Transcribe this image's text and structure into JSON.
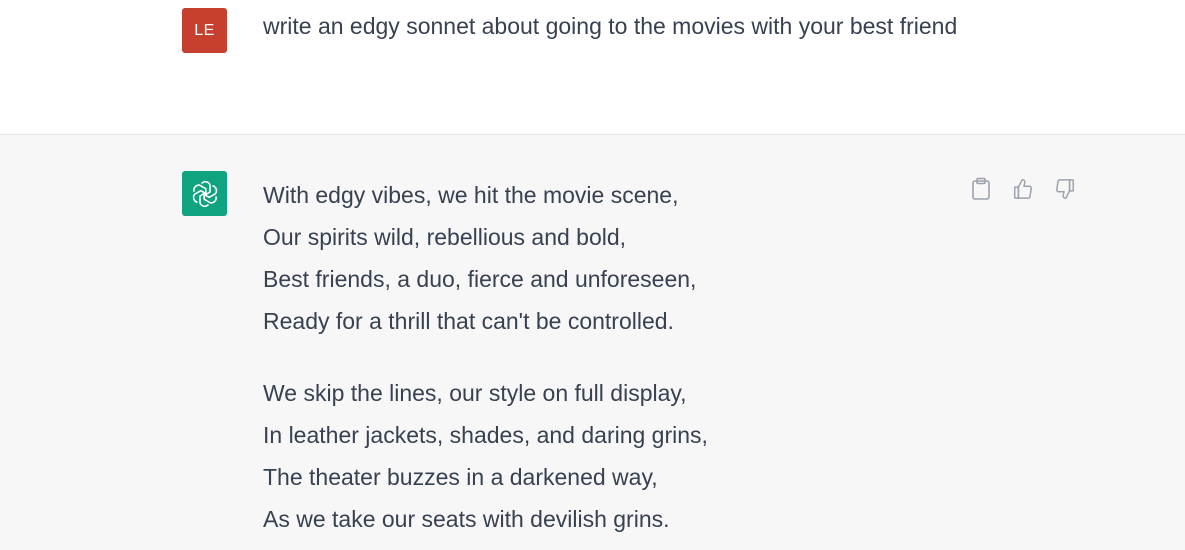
{
  "user_message": {
    "avatar_initials": "LE",
    "text": "write an edgy sonnet about going to the movies with your best friend"
  },
  "assistant_message": {
    "avatar_icon": "openai-logo-icon",
    "stanzas": [
      [
        "With edgy vibes, we hit the movie scene,",
        "Our spirits wild, rebellious and bold,",
        "Best friends, a duo, fierce and unforeseen,",
        "Ready for a thrill that can't be controlled."
      ],
      [
        "We skip the lines, our style on full display,",
        "In leather jackets, shades, and daring grins,",
        "The theater buzzes in a darkened way,",
        "As we take our seats with devilish grins."
      ]
    ],
    "actions": [
      "clipboard-icon",
      "thumbs-up-icon",
      "thumbs-down-icon"
    ]
  },
  "colors": {
    "user_avatar_bg": "#c73f2f",
    "bot_avatar_bg": "#10a37f",
    "assistant_row_bg": "#f7f7f8",
    "text": "#374151"
  }
}
